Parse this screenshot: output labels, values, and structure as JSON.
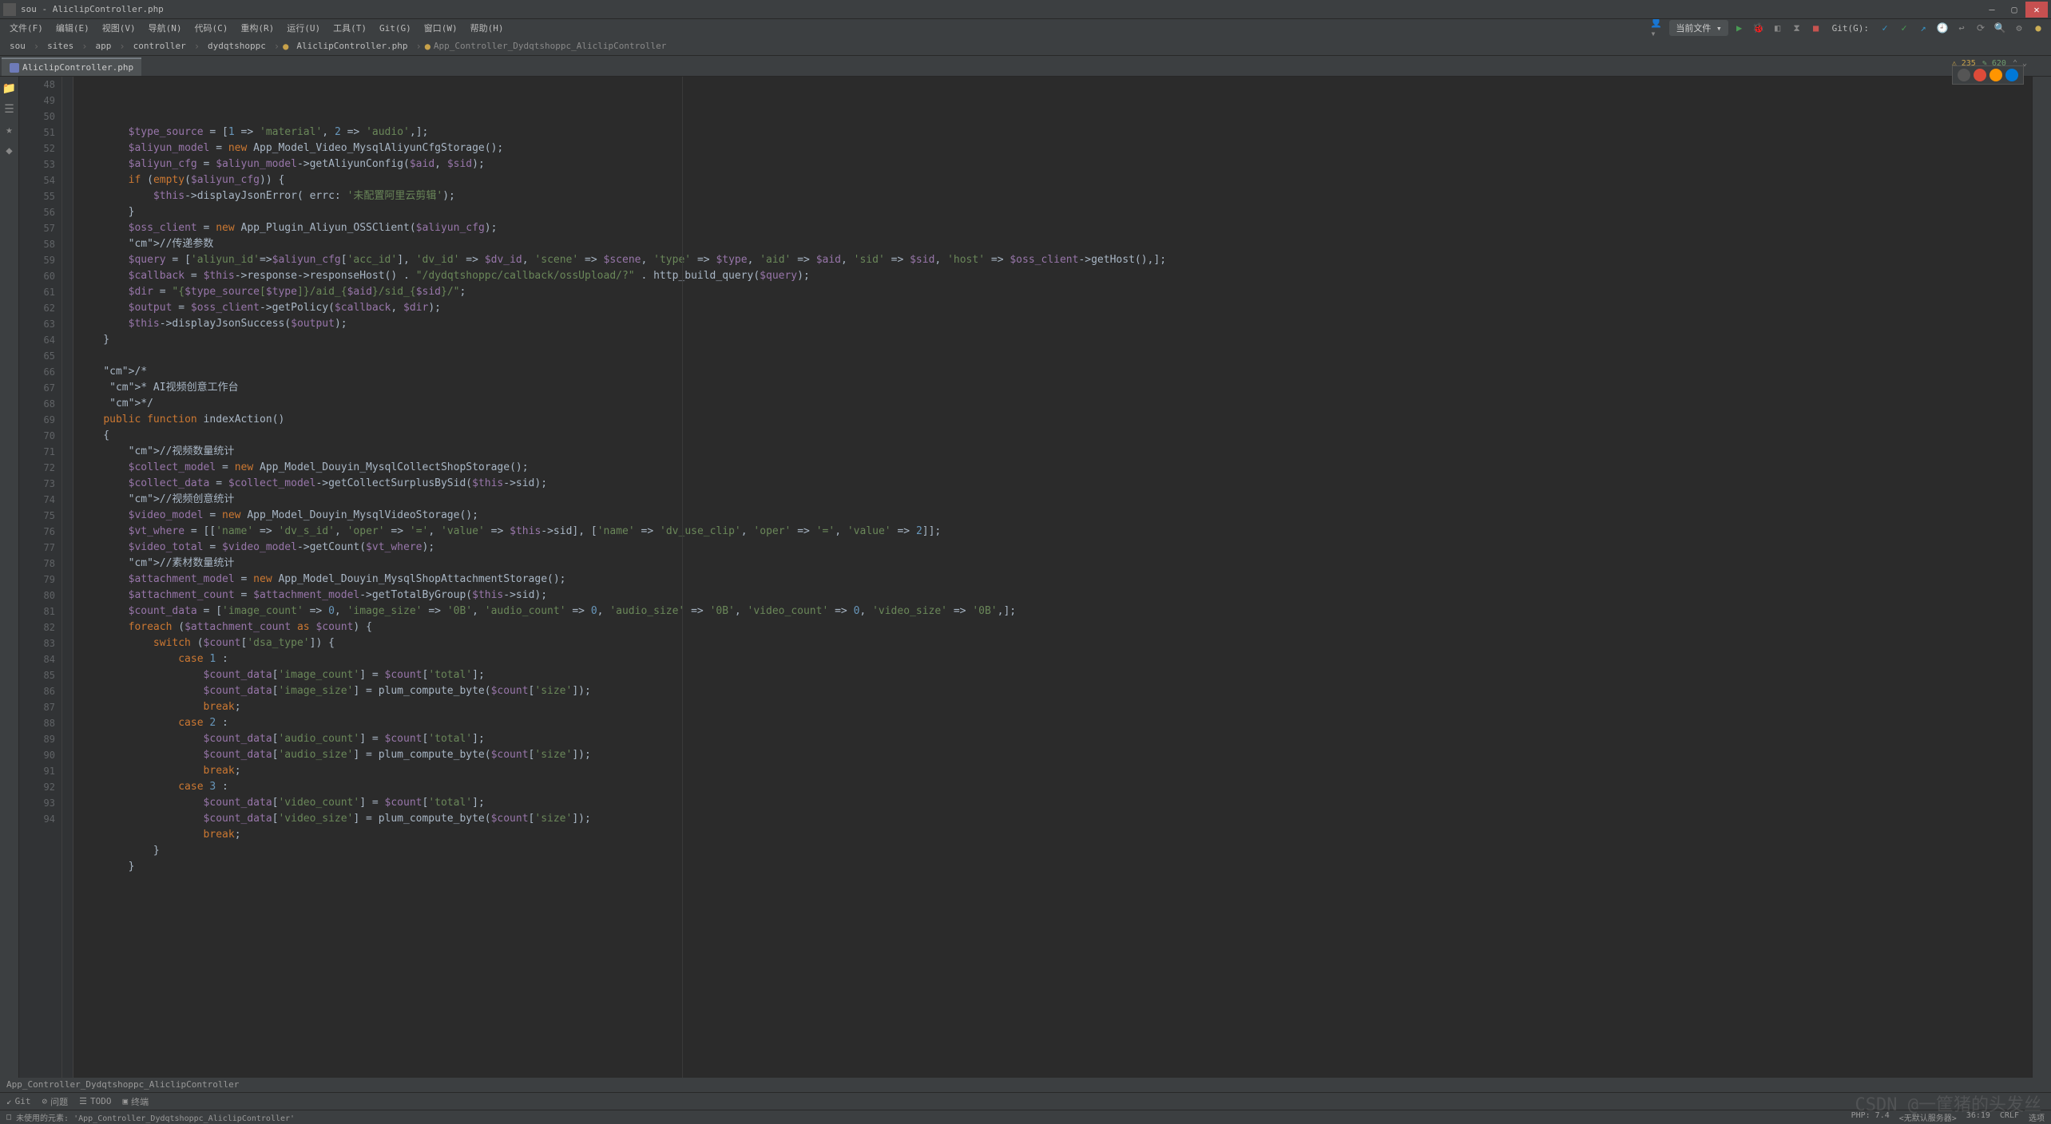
{
  "window": {
    "title": "sou - AliclipController.php"
  },
  "menu": {
    "items": [
      "文件(F)",
      "编辑(E)",
      "视图(V)",
      "导航(N)",
      "代码(C)",
      "重构(R)",
      "运行(U)",
      "工具(T)",
      "Git(G)",
      "窗口(W)",
      "帮助(H)"
    ],
    "git_label": "Git(G):",
    "run_config": "当前文件"
  },
  "breadcrumbs": {
    "parts": [
      "sou",
      "sites",
      "app",
      "controller",
      "dydqtshoppc"
    ],
    "file": "AliclipController.php",
    "context": "App_Controller_Dydqtshoppc_AliclipController"
  },
  "tab": {
    "name": "AliclipController.php"
  },
  "inspection": {
    "warnings": "235",
    "typos": "620"
  },
  "editor": {
    "first_line": 48,
    "lines": [
      "        $type_source = [1 => 'material', 2 => 'audio',];",
      "        $aliyun_model = new App_Model_Video_MysqlAliyunCfgStorage();",
      "        $aliyun_cfg = $aliyun_model->getAliyunConfig($aid, $sid);",
      "        if (empty($aliyun_cfg)) {",
      "            $this->displayJsonError( errc: '未配置阿里云剪辑');",
      "        }",
      "        $oss_client = new App_Plugin_Aliyun_OSSClient($aliyun_cfg);",
      "        //传递参数",
      "        $query = ['aliyun_id'=>$aliyun_cfg['acc_id'], 'dv_id' => $dv_id, 'scene' => $scene, 'type' => $type, 'aid' => $aid, 'sid' => $sid, 'host' => $oss_client->getHost(),];",
      "        $callback = $this->response->responseHost() . \"/dydqtshoppc/callback/ossUpload/?\" . http_build_query($query);",
      "        $dir = \"{$type_source[$type]}/aid_{$aid}/sid_{$sid}/\";",
      "        $output = $oss_client->getPolicy($callback, $dir);",
      "        $this->displayJsonSuccess($output);",
      "    }",
      "",
      "    /*",
      "     * AI视频创意工作台",
      "     */",
      "    public function indexAction()",
      "    {",
      "        //视频数量统计",
      "        $collect_model = new App_Model_Douyin_MysqlCollectShopStorage();",
      "        $collect_data = $collect_model->getCollectSurplusBySid($this->sid);",
      "        //视频创意统计",
      "        $video_model = new App_Model_Douyin_MysqlVideoStorage();",
      "        $vt_where = [['name' => 'dv_s_id', 'oper' => '=', 'value' => $this->sid], ['name' => 'dv_use_clip', 'oper' => '=', 'value' => 2]];",
      "        $video_total = $video_model->getCount($vt_where);",
      "        //素材数量统计",
      "        $attachment_model = new App_Model_Douyin_MysqlShopAttachmentStorage();",
      "        $attachment_count = $attachment_model->getTotalByGroup($this->sid);",
      "        $count_data = ['image_count' => 0, 'image_size' => '0B', 'audio_count' => 0, 'audio_size' => '0B', 'video_count' => 0, 'video_size' => '0B',];",
      "        foreach ($attachment_count as $count) {",
      "            switch ($count['dsa_type']) {",
      "                case 1 :",
      "                    $count_data['image_count'] = $count['total'];",
      "                    $count_data['image_size'] = plum_compute_byte($count['size']);",
      "                    break;",
      "                case 2 :",
      "                    $count_data['audio_count'] = $count['total'];",
      "                    $count_data['audio_size'] = plum_compute_byte($count['size']);",
      "                    break;",
      "                case 3 :",
      "                    $count_data['video_count'] = $count['total'];",
      "                    $count_data['video_size'] = plum_compute_byte($count['size']);",
      "                    break;",
      "            }",
      "        }"
    ]
  },
  "editor_crumb": "App_Controller_Dydqtshoppc_AliclipController",
  "bottom_tools": {
    "git": "Git",
    "problems": "问题",
    "todo": "TODO",
    "terminal": "终端"
  },
  "status": {
    "left_icon": "□",
    "left": "未使用的元素: 'App_Controller_Dydqtshoppc_AliclipController'",
    "php": "PHP: 7.4",
    "interp": "<无默认服务器>",
    "pos": "36:19",
    "eol": "CRLF",
    "enc": "选项",
    "spaces": "",
    "watermark": "CSDN @一筐猪的头发丝"
  }
}
